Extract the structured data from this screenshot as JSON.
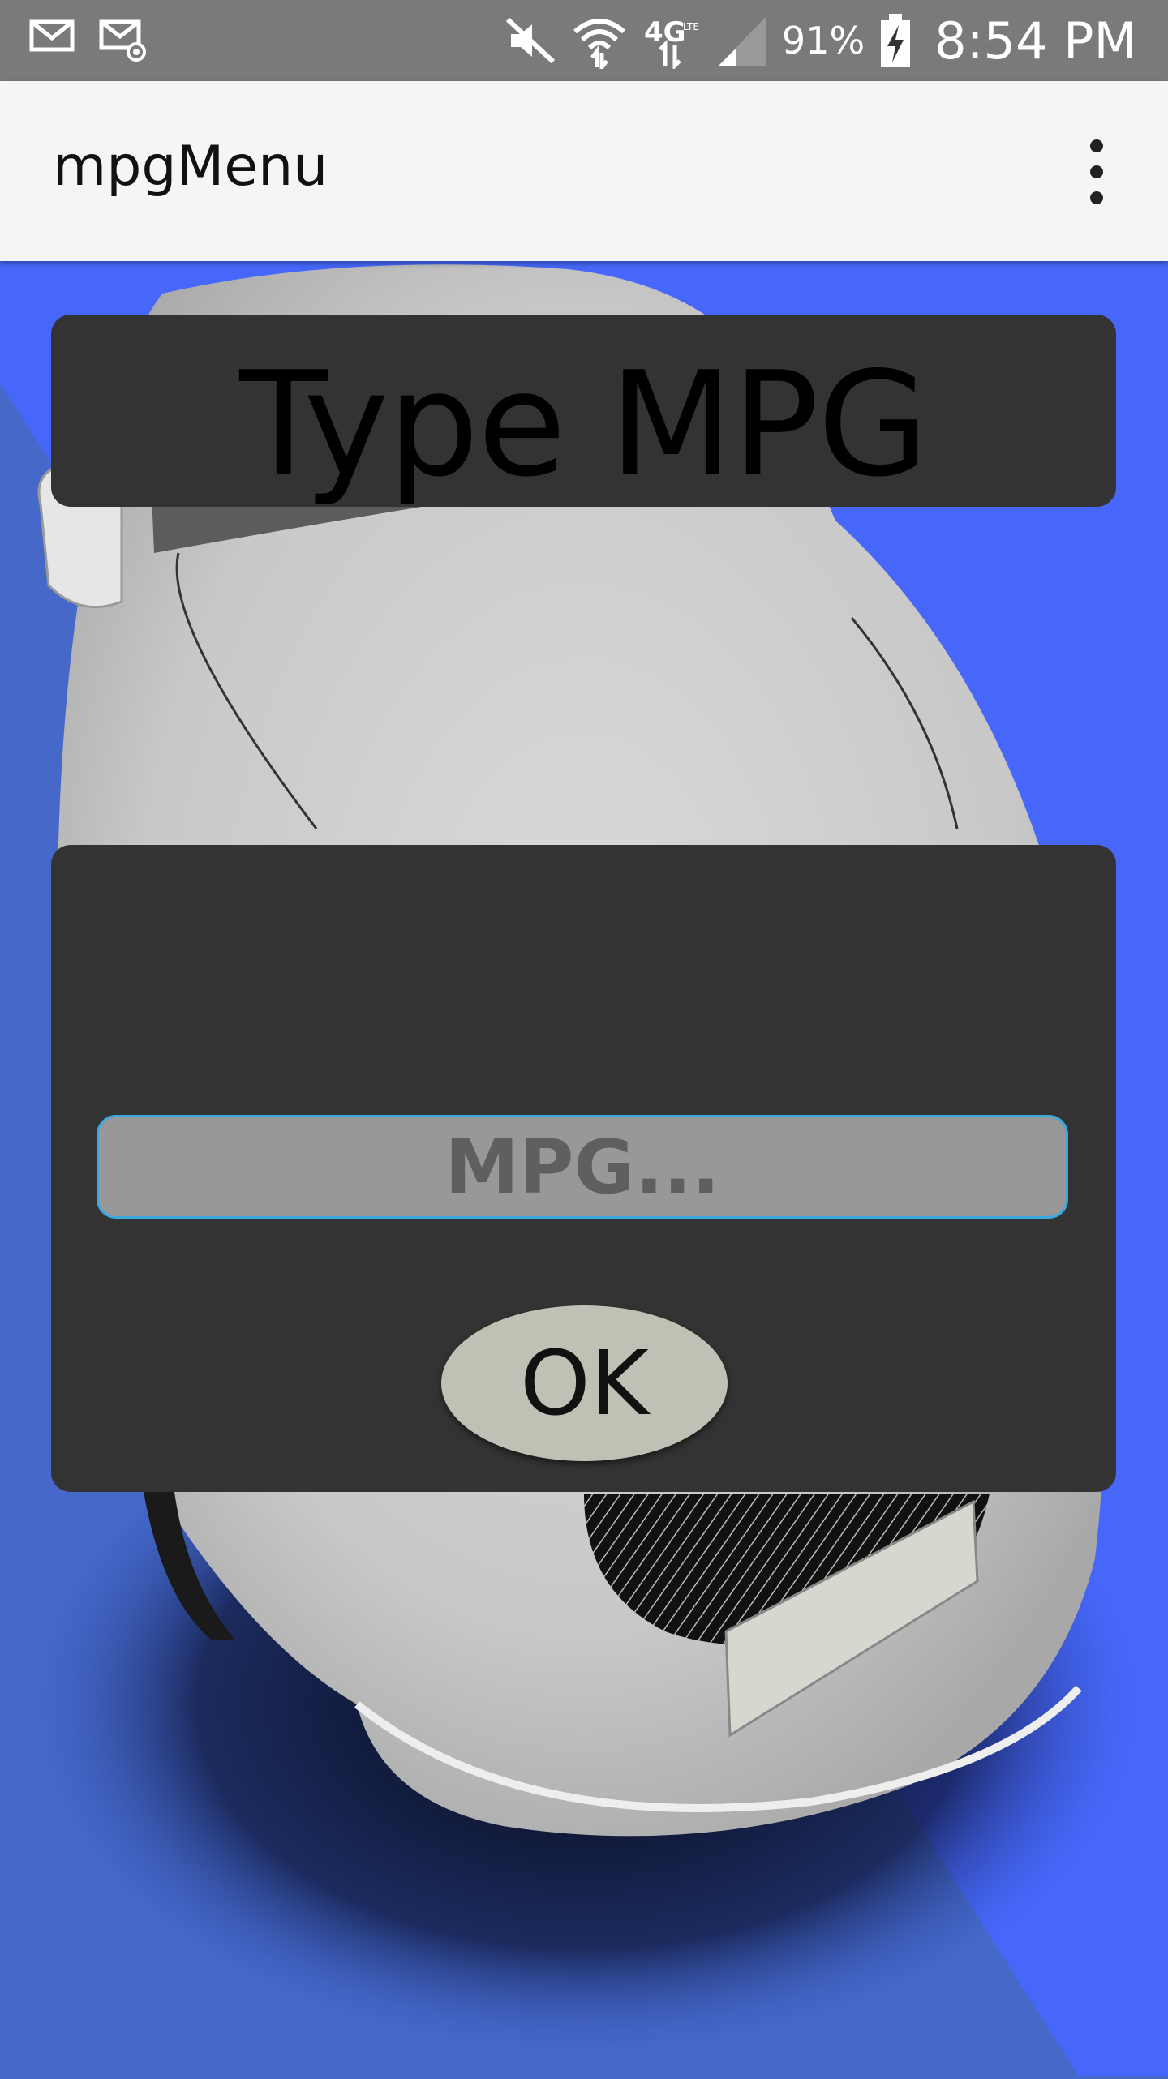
{
  "status_bar": {
    "icons": [
      "mail-icon",
      "email-at-icon",
      "mute-icon",
      "wifi-icon",
      "network-4g-lte-icon",
      "signal-icon",
      "battery-charging-icon"
    ],
    "battery": "91%",
    "time": "8:54 PM"
  },
  "app_bar": {
    "title": "mpgMenu",
    "menu_icon": "overflow-menu-icon"
  },
  "main": {
    "heading": "Type MPG",
    "input": {
      "value": "",
      "placeholder": "MPG..."
    },
    "ok_label": "OK"
  },
  "colors": {
    "status_bar": "#7a7a7a",
    "app_bar": "#f5f5f5",
    "panel": "#333333",
    "input_bg": "#989898",
    "input_border": "#3ba8e0",
    "button": "#c0c0b4",
    "background_blue": "#4568c9",
    "background_blue_light": "#4767fb",
    "car_body": "#d0d0d0"
  },
  "background_image": "car-front-illustration"
}
